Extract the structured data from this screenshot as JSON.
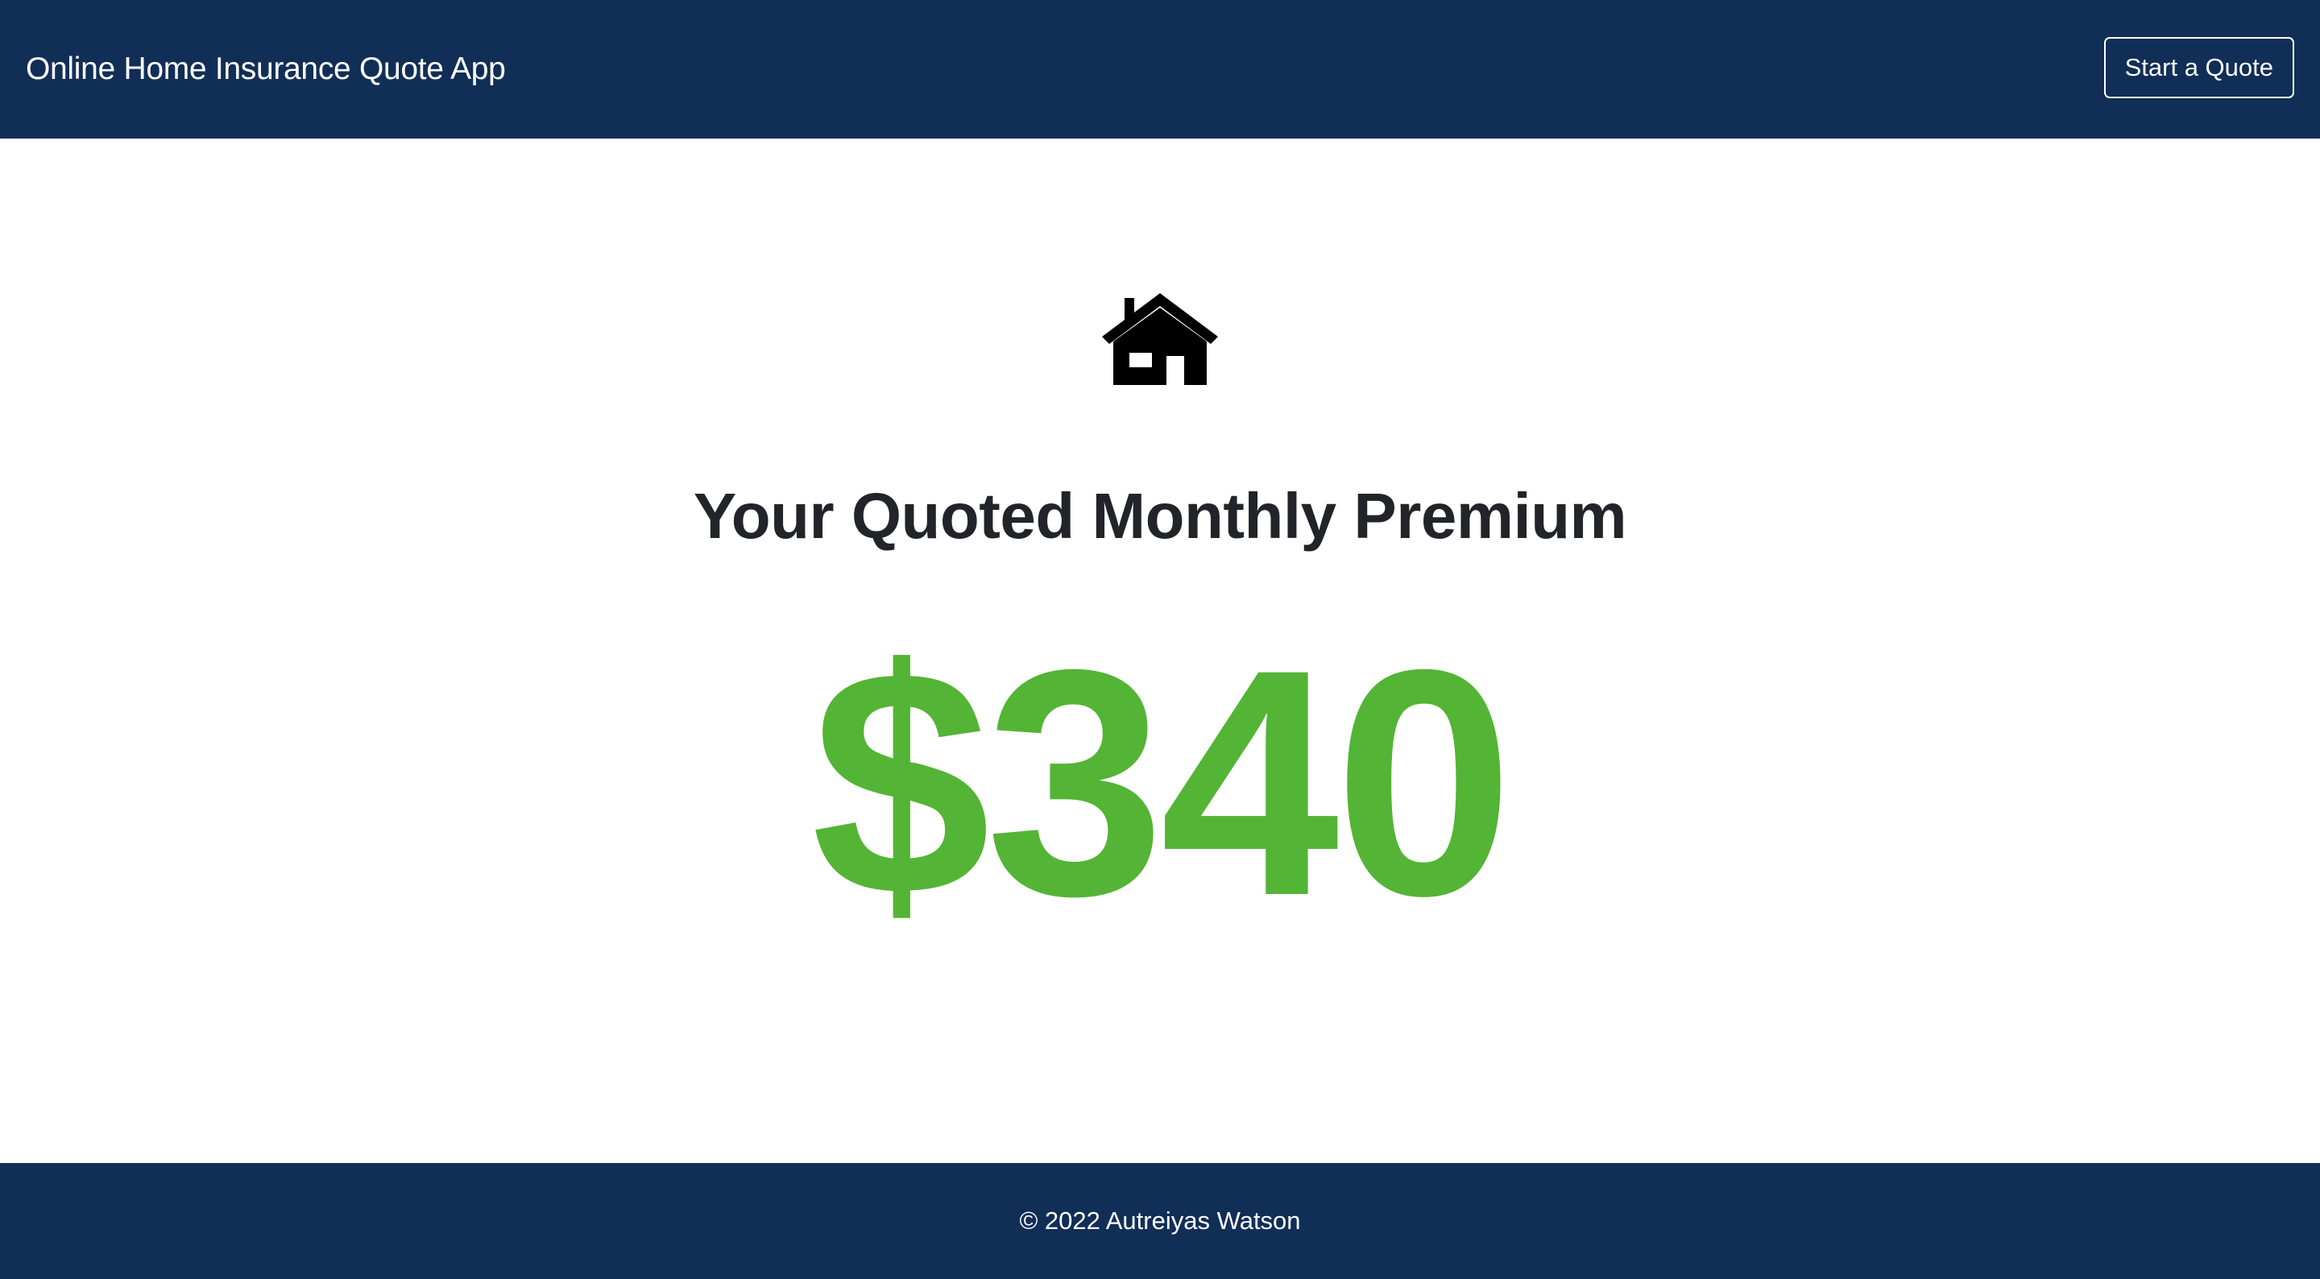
{
  "navbar": {
    "brand": "Online Home Insurance Quote App",
    "start_quote_label": "Start a Quote",
    "background_color": "#112e57"
  },
  "main": {
    "icon": "house-icon",
    "heading": "Your Quoted Monthly Premium",
    "premium_amount": "$340",
    "premium_color": "#54b435"
  },
  "footer": {
    "text": "© 2022 Autreiyas Watson"
  }
}
